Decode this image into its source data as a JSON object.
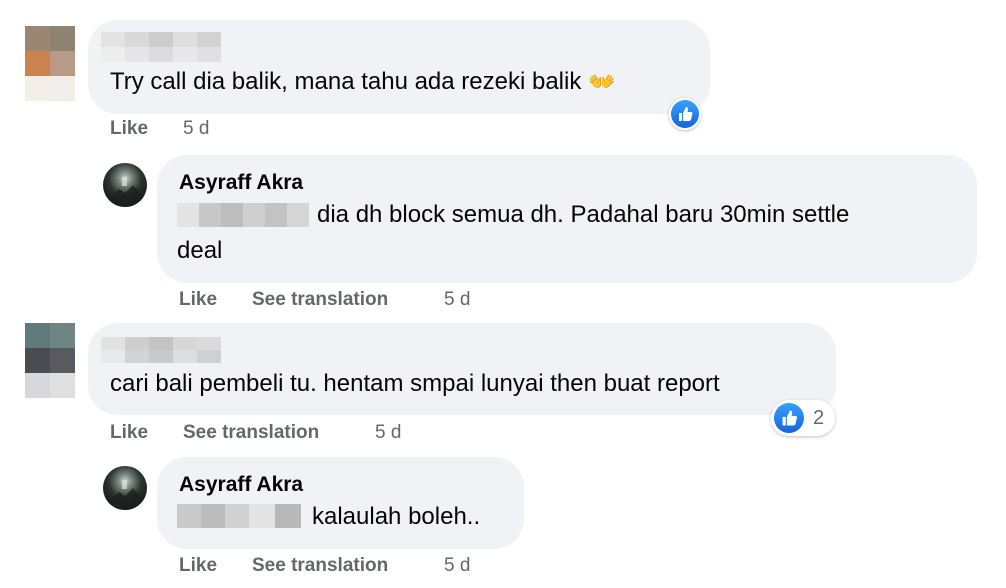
{
  "comments": [
    {
      "text": "Try call dia balik, mana tahu ada rezeki balik",
      "emoji": "👐",
      "actions": {
        "like": "Like",
        "time": "5 d"
      },
      "reaction": {
        "icon": "like-icon"
      }
    },
    {
      "author": "Asyraff Akra",
      "text_line1": "dia dh block semua dh. Padahal baru 30min settle",
      "text_line2": "deal",
      "actions": {
        "like": "Like",
        "translate": "See translation",
        "time": "5 d"
      }
    },
    {
      "text": "cari bali pembeli tu. hentam smpai lunyai then buat report",
      "actions": {
        "like": "Like",
        "translate": "See translation",
        "time": "5 d"
      },
      "reaction": {
        "icon": "like-icon",
        "count": "2"
      }
    },
    {
      "author": "Asyraff Akra",
      "text": "kalaulah boleh..",
      "actions": {
        "like": "Like",
        "translate": "See translation",
        "time": "5 d"
      }
    }
  ],
  "colors": {
    "bubble": "#f0f2f5",
    "meta_text": "#65676b",
    "like_blue": "#1877f2"
  }
}
